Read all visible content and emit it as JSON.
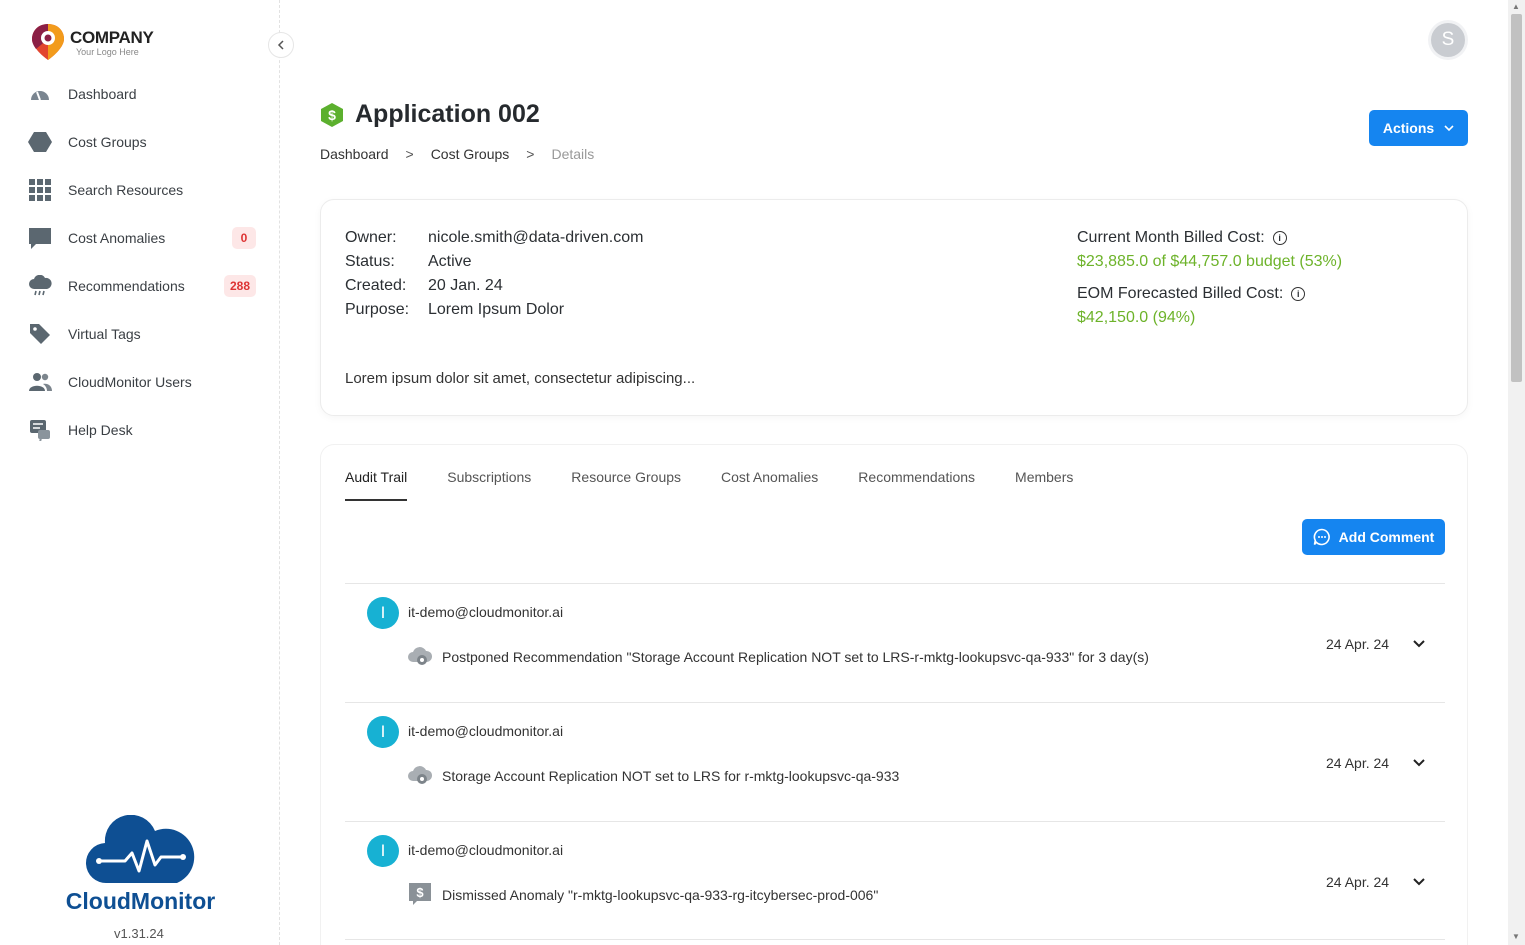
{
  "sidebar": {
    "logo": {
      "name": "COMPANY",
      "tagline": "Your Logo Here"
    },
    "items": [
      {
        "label": "Dashboard",
        "icon": "gauge-icon"
      },
      {
        "label": "Cost Groups",
        "icon": "hexagon-icon"
      },
      {
        "label": "Search Resources",
        "icon": "grid-icon"
      },
      {
        "label": "Cost Anomalies",
        "icon": "chat-bubble-icon",
        "badge": "0"
      },
      {
        "label": "Recommendations",
        "icon": "cloud-rain-icon",
        "badge": "288"
      },
      {
        "label": "Virtual Tags",
        "icon": "tag-icon"
      },
      {
        "label": "CloudMonitor Users",
        "icon": "users-icon"
      },
      {
        "label": "Help Desk",
        "icon": "helpdesk-icon"
      }
    ],
    "brand": "CloudMonitor",
    "version": "v1.31.24"
  },
  "header": {
    "avatar_initial": "S",
    "title": "Application 002",
    "breadcrumb": [
      "Dashboard",
      "Cost Groups",
      "Details"
    ],
    "breadcrumb_sep": ">",
    "actions_label": "Actions"
  },
  "info": {
    "owner_label": "Owner:",
    "owner": "nicole.smith@data-driven.com",
    "status_label": "Status:",
    "status": "Active",
    "created_label": "Created:",
    "created": "20 Jan. 24",
    "purpose_label": "Purpose:",
    "purpose": "Lorem Ipsum Dolor",
    "description": "Lorem ipsum dolor sit amet, consectetur adipiscing...",
    "current_cost_label": "Current Month Billed Cost:",
    "current_cost": "$23,885.0 of $44,757.0 budget (53%)",
    "eom_label": "EOM Forecasted Billed Cost:",
    "eom_cost": "$42,150.0 (94%)"
  },
  "tabs": [
    "Audit Trail",
    "Subscriptions",
    "Resource Groups",
    "Cost Anomalies",
    "Recommendations",
    "Members"
  ],
  "add_comment_label": "Add Comment",
  "audit": [
    {
      "initial": "I",
      "user": "it-demo@cloudmonitor.ai",
      "icon": "cloud-gear-icon",
      "text": "Postponed Recommendation \"Storage Account Replication NOT set to LRS-r-mktg-lookupsvc-qa-933\" for 3 day(s)",
      "date": "24 Apr. 24"
    },
    {
      "initial": "I",
      "user": "it-demo@cloudmonitor.ai",
      "icon": "cloud-gear-icon",
      "text": "Storage Account Replication NOT set to LRS for r-mktg-lookupsvc-qa-933",
      "date": "24 Apr. 24"
    },
    {
      "initial": "I",
      "user": "it-demo@cloudmonitor.ai",
      "icon": "dollar-chat-icon",
      "text": "Dismissed Anomaly \"r-mktg-lookupsvc-qa-933-rg-itcybersec-prod-006\"",
      "date": "24 Apr. 24"
    }
  ],
  "colors": {
    "primary": "#1585f0",
    "cost_green": "#6db32a",
    "user_dot": "#17b1d3",
    "badge_bg": "#fde7e7",
    "badge_text": "#dd3333"
  }
}
